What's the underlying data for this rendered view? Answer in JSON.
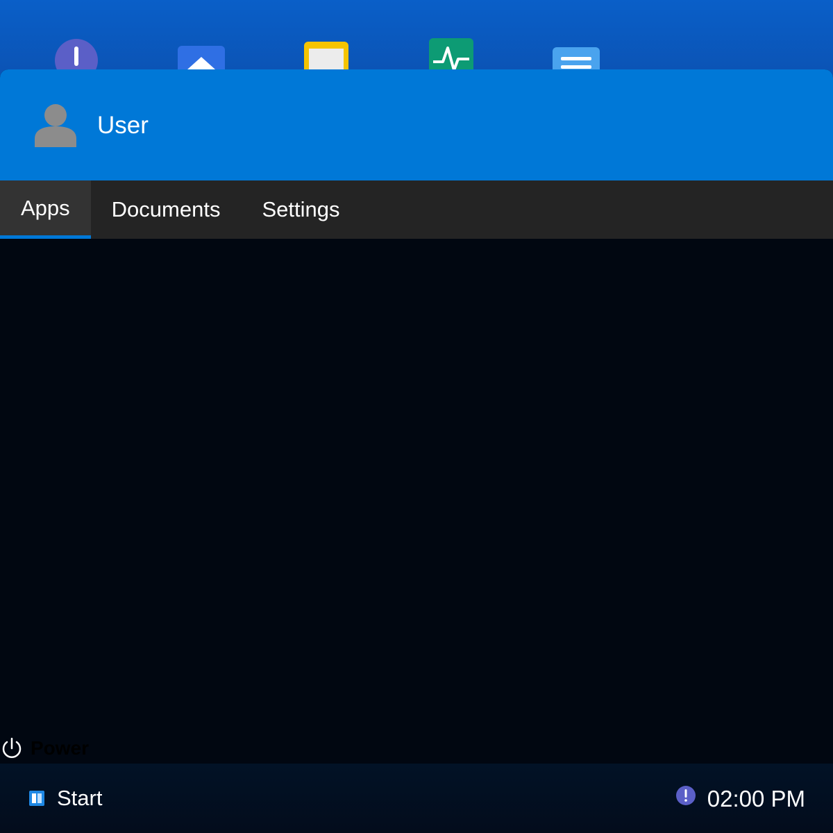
{
  "desktop": {
    "icons": [
      {
        "name": "alert-app-icon"
      },
      {
        "name": "up-arrow-app-icon"
      },
      {
        "name": "notes-app-icon"
      },
      {
        "name": "activity-monitor-app-icon"
      },
      {
        "name": "text-editor-app-icon"
      }
    ]
  },
  "start_menu": {
    "user": {
      "name": "User",
      "avatar_icon": "user-avatar-icon"
    },
    "tabs": [
      {
        "label": "Apps",
        "active": true
      },
      {
        "label": "Documents",
        "active": false
      },
      {
        "label": "Settings",
        "active": false
      }
    ],
    "power": {
      "label": "Power",
      "icon": "power-icon"
    }
  },
  "taskbar": {
    "start_label": "Start",
    "start_icon": "start-logo-icon",
    "tray_icon": "notification-alert-icon",
    "clock": "02:00 PM"
  },
  "colors": {
    "accent": "#0078d7",
    "tab_bar": "#242424",
    "menu_body": "#010711",
    "alert_purple": "#5b5fc7"
  }
}
